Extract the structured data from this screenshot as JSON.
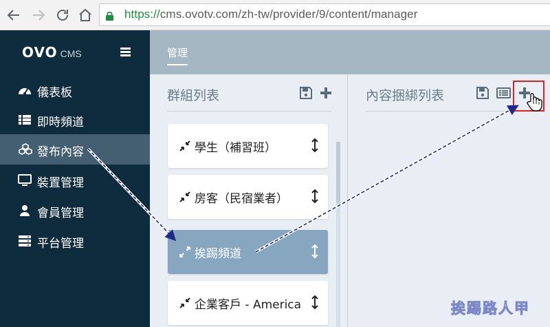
{
  "browser": {
    "url_scheme": "https://",
    "url_rest": "cms.ovotv.com/zh-tw/provider/9/content/manager",
    "back_icon": "arrow-left-icon",
    "forward_icon": "arrow-right-icon",
    "reload_icon": "reload-icon",
    "home_icon": "home-icon",
    "lock_icon": "lock-icon"
  },
  "sidebar": {
    "logo_ovo": "OVO",
    "logo_cms": "CMS",
    "items": [
      {
        "label": "儀表板",
        "icon": "dashboard-icon",
        "active": false
      },
      {
        "label": "即時頻道",
        "icon": "list-icon",
        "active": false
      },
      {
        "label": "發布內容",
        "icon": "cubes-icon",
        "active": true
      },
      {
        "label": "裝置管理",
        "icon": "monitor-icon",
        "active": false
      },
      {
        "label": "會員管理",
        "icon": "user-icon",
        "active": false
      },
      {
        "label": "平台管理",
        "icon": "server-icon",
        "active": false
      }
    ]
  },
  "topbar": {
    "tab": "管理"
  },
  "group_panel": {
    "title": "群組列表",
    "cards": [
      {
        "label": "學生（補習班）",
        "icon": "compress-icon",
        "active": false
      },
      {
        "label": "房客（民宿業者）",
        "icon": "compress-icon",
        "active": false
      },
      {
        "label": "挨踢頻道",
        "icon": "expand-icon",
        "active": true
      },
      {
        "label": "企業客戶 - America",
        "icon": "compress-icon",
        "active": false
      }
    ]
  },
  "bind_panel": {
    "title": "內容捆綁列表"
  },
  "watermark": "挨踢路人甲",
  "colors": {
    "sidebar": "#0f2b3e",
    "sidebar_active": "#445f72",
    "topbar": "#a6b7c4",
    "content_bg": "#e8eef3",
    "card_active": "#86a7bf",
    "highlight": "#e02020",
    "arrow": "#1f2a8c"
  }
}
